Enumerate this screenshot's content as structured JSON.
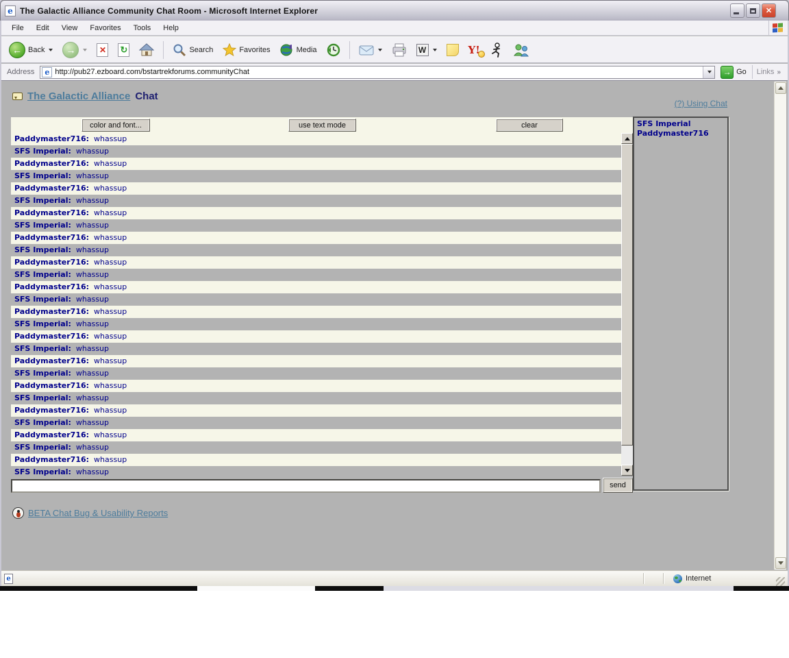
{
  "window": {
    "title": "The Galactic Alliance Community Chat Room - Microsoft Internet Explorer"
  },
  "menu_bar": {
    "items": [
      "File",
      "Edit",
      "View",
      "Favorites",
      "Tools",
      "Help"
    ]
  },
  "toolbar": {
    "back_label": "Back",
    "search_label": "Search",
    "favorites_label": "Favorites",
    "media_label": "Media"
  },
  "address_bar": {
    "label": "Address",
    "url": "http://pub27.ezboard.com/bstartrekforums.communityChat",
    "go_label": "Go",
    "links_label": "Links",
    "links_chevron": "»"
  },
  "content": {
    "header": {
      "board_link": "The Galactic Alliance",
      "page_title": "Chat",
      "help_link": "(?) Using Chat"
    },
    "chat": {
      "toolbar_buttons": [
        {
          "label": "color and font..."
        },
        {
          "label": "use text mode"
        },
        {
          "label": "clear"
        }
      ],
      "messages": [
        {
          "user": "Paddymaster716:",
          "text": "whassup"
        },
        {
          "user": "SFS Imperial:",
          "text": "whassup"
        },
        {
          "user": "Paddymaster716:",
          "text": "whassup"
        },
        {
          "user": "SFS Imperial:",
          "text": "whassup"
        },
        {
          "user": "Paddymaster716:",
          "text": "whassup"
        },
        {
          "user": "SFS Imperial:",
          "text": "whassup"
        },
        {
          "user": "Paddymaster716:",
          "text": "whassup"
        },
        {
          "user": "SFS Imperial:",
          "text": "whassup"
        },
        {
          "user": "Paddymaster716:",
          "text": "whassup"
        },
        {
          "user": "SFS Imperial:",
          "text": "whassup"
        },
        {
          "user": "Paddymaster716:",
          "text": "whassup"
        },
        {
          "user": "SFS Imperial:",
          "text": "whassup"
        },
        {
          "user": "Paddymaster716:",
          "text": "whassup"
        },
        {
          "user": "SFS Imperial:",
          "text": "whassup"
        },
        {
          "user": "Paddymaster716:",
          "text": "whassup"
        },
        {
          "user": "SFS Imperial:",
          "text": "whassup"
        },
        {
          "user": "Paddymaster716:",
          "text": "whassup"
        },
        {
          "user": "SFS Imperial:",
          "text": "whassup"
        },
        {
          "user": "Paddymaster716:",
          "text": "whassup"
        },
        {
          "user": "SFS Imperial:",
          "text": "whassup"
        },
        {
          "user": "Paddymaster716:",
          "text": "whassup"
        },
        {
          "user": "SFS Imperial:",
          "text": "whassup"
        },
        {
          "user": "Paddymaster716:",
          "text": "whassup"
        },
        {
          "user": "SFS Imperial:",
          "text": "whassup"
        },
        {
          "user": "Paddymaster716:",
          "text": "whassup"
        },
        {
          "user": "SFS Imperial:",
          "text": "whassup"
        },
        {
          "user": "Paddymaster716:",
          "text": "whassup"
        },
        {
          "user": "SFS Imperial:",
          "text": "whassup"
        }
      ],
      "input": {
        "value": "",
        "send_label": "send"
      }
    },
    "user_list": {
      "users": [
        "SFS Imperial",
        "Paddymaster716"
      ]
    },
    "beta_report_link": "BETA Chat Bug & Usability Reports"
  },
  "status_bar": {
    "zone_label": "Internet"
  },
  "colors": {
    "link_blue": "#4d7c9c",
    "chat_navy": "#00008b",
    "chat_cream": "#f6f6e8",
    "page_gray": "#b3b3b3",
    "close_red": "#dd5a40",
    "go_green": "#2f9e2b"
  }
}
